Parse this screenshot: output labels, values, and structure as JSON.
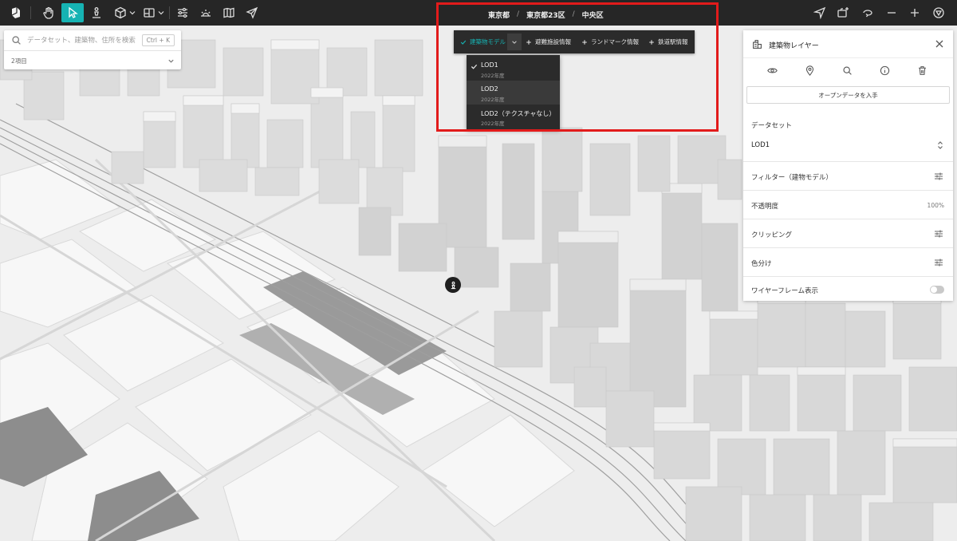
{
  "toolbar": {
    "tools": [
      {
        "name": "logo",
        "icon": "reearth-logo-icon"
      },
      {
        "name": "hand",
        "icon": "hand-icon"
      },
      {
        "name": "select",
        "icon": "cursor-arrow-icon"
      },
      {
        "name": "pedestrian",
        "icon": "pedestrian-icon"
      },
      {
        "name": "cube",
        "icon": "cube-icon"
      },
      {
        "name": "map-style",
        "icon": "map-style-icon"
      },
      {
        "name": "layer-settings",
        "icon": "sliders-icon"
      },
      {
        "name": "sun",
        "icon": "sunrise-icon"
      },
      {
        "name": "book",
        "icon": "book-map-icon"
      },
      {
        "name": "send",
        "icon": "paper-plane-icon"
      }
    ],
    "right_tools": [
      {
        "name": "location",
        "icon": "navigate-arrow-icon"
      },
      {
        "name": "screenshot",
        "icon": "camera-plus-icon"
      },
      {
        "name": "rotate",
        "icon": "rotate-icon"
      },
      {
        "name": "zoom-out",
        "icon": "minus-icon"
      },
      {
        "name": "zoom-in",
        "icon": "plus-icon"
      },
      {
        "name": "compass",
        "icon": "compass-icon"
      }
    ],
    "accent": "#16b3b3"
  },
  "breadcrumb": [
    "東京都",
    "東京都23区",
    "中央区"
  ],
  "search": {
    "placeholder": "データセット、建築物、住所を検索",
    "shortcut": "Ctrl + K",
    "count": "2項目"
  },
  "layerbar": {
    "tabs": [
      {
        "label": "建築物モデル",
        "selected": true
      },
      {
        "label": "避難施設情報",
        "selected": false
      },
      {
        "label": "ランドマーク情報",
        "selected": false
      },
      {
        "label": "鉄道駅情報",
        "selected": false
      }
    ]
  },
  "lod_dropdown": {
    "items": [
      {
        "label": "LOD1",
        "year": "2022年度",
        "checked": true
      },
      {
        "label": "LOD2",
        "year": "2022年度",
        "checked": false
      },
      {
        "label": "LOD2（テクスチャなし）",
        "year": "2022年度",
        "checked": false
      }
    ]
  },
  "panel": {
    "title": "建築物レイヤー",
    "icons": [
      "eye-icon",
      "map-pin-icon",
      "search-icon",
      "info-icon",
      "trash-icon"
    ],
    "open_data_button": "オープンデータを入手",
    "dataset_label": "データセット",
    "dataset_value": "LOD1",
    "rows": [
      {
        "label": "フィルター（建物モデル）",
        "type": "adjust"
      },
      {
        "label": "不透明度",
        "type": "value",
        "value": "100%"
      },
      {
        "label": "クリッピング",
        "type": "adjust"
      },
      {
        "label": "色分け",
        "type": "adjust"
      },
      {
        "label": "ワイヤーフレーム表示",
        "type": "toggle",
        "on": false
      }
    ]
  },
  "highlight_color": "#e21b1b"
}
